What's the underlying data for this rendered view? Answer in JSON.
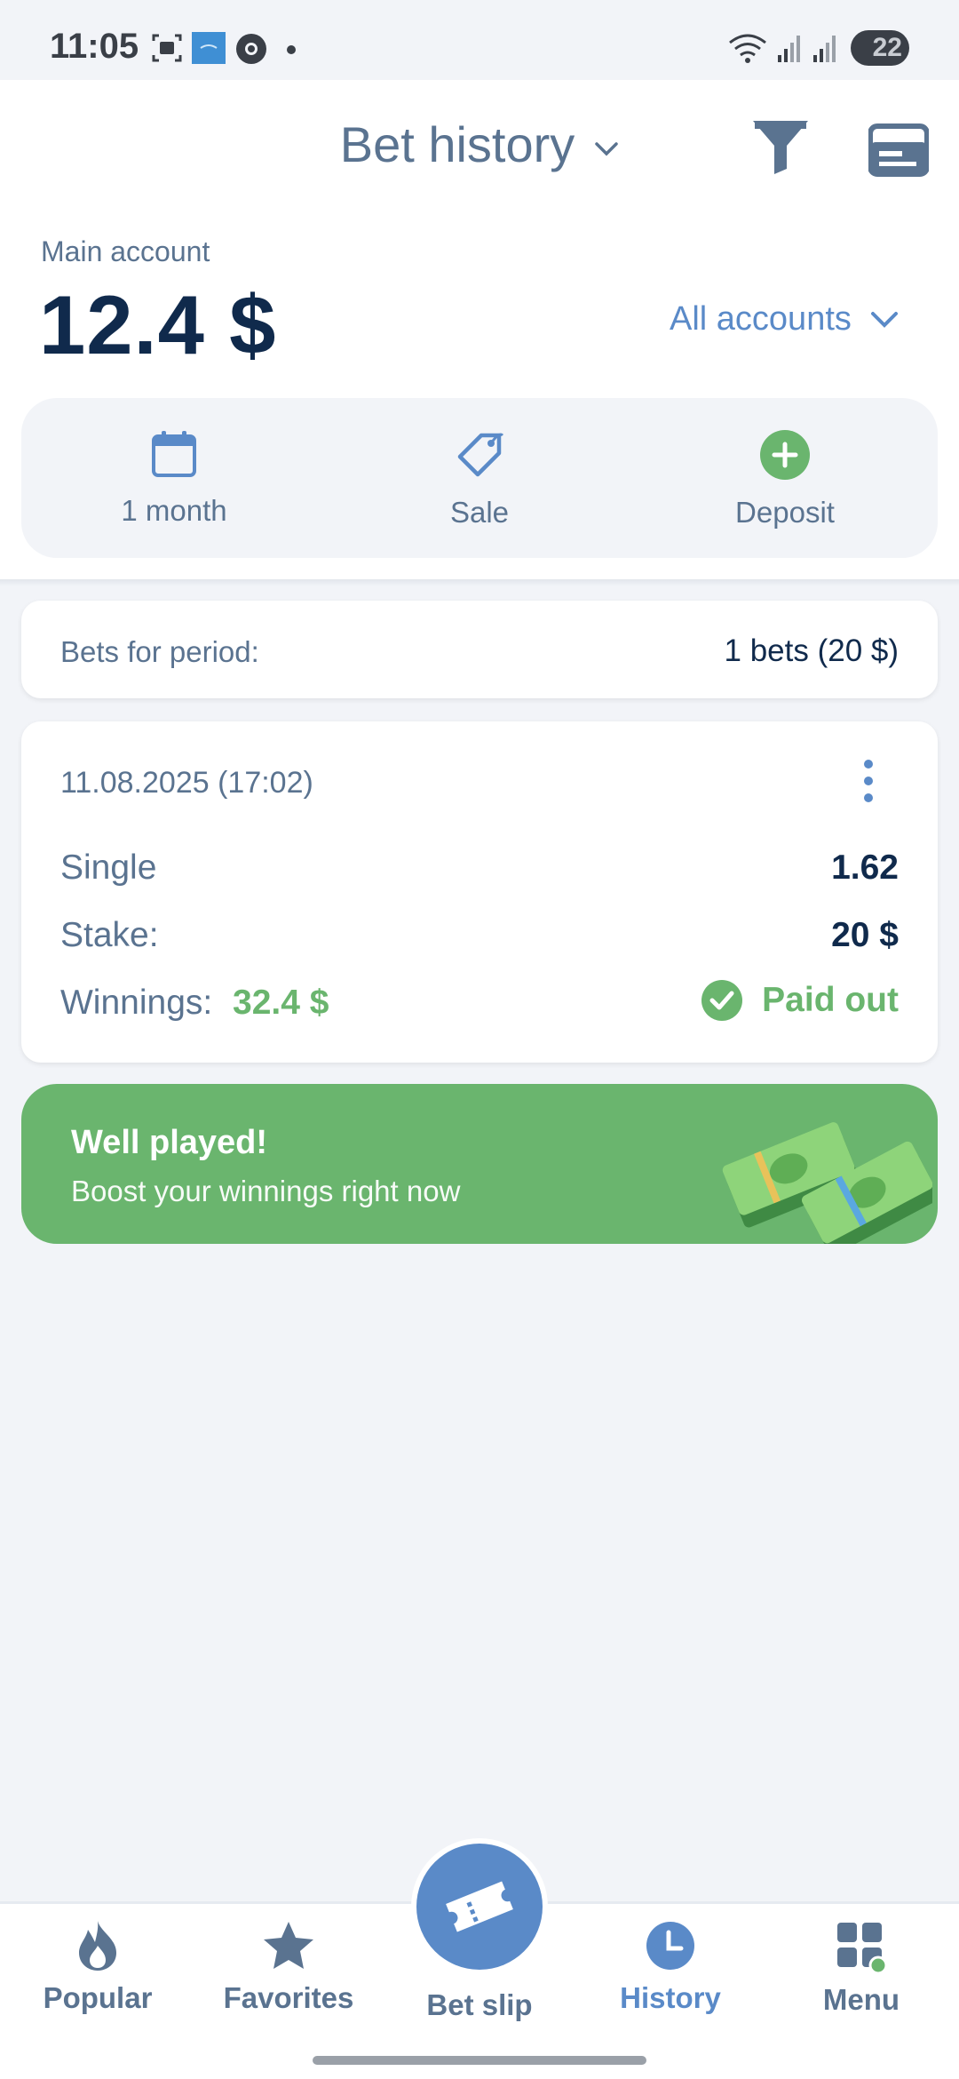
{
  "status_bar": {
    "time": "11:05",
    "battery": "22"
  },
  "header": {
    "title": "Bet history",
    "main_account_label": "Main account",
    "balance": "12.4 $",
    "all_accounts": "All accounts"
  },
  "actions": [
    {
      "label": "1 month",
      "icon": "calendar-icon"
    },
    {
      "label": "Sale",
      "icon": "tag-icon"
    },
    {
      "label": "Deposit",
      "icon": "plus-circle-icon"
    }
  ],
  "period": {
    "label": "Bets for period:",
    "value": "1 bets (20 $)"
  },
  "bet": {
    "date": "11.08.2025 (17:02)",
    "type": "Single",
    "odds": "1.62",
    "stake_label": "Stake:",
    "stake_value": "20 $",
    "winnings_label": "Winnings:",
    "winnings_value": "32.4 $",
    "status": "Paid out"
  },
  "promo": {
    "title": "Well played!",
    "subtitle": "Boost your winnings right now"
  },
  "nav": {
    "popular": "Popular",
    "favorites": "Favorites",
    "bet_slip": "Bet slip",
    "history": "History",
    "menu": "Menu"
  },
  "colors": {
    "accent": "#5a8ac8",
    "success": "#6ab56e",
    "dark_text": "#102a4c",
    "muted_text": "#5a7390"
  }
}
